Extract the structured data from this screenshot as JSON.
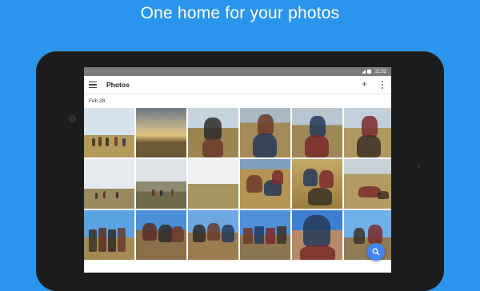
{
  "headline": "One home for your photos",
  "status_bar": {
    "time": "11:52"
  },
  "app_bar": {
    "title": "Photos",
    "menu_icon": "hamburger-menu-icon",
    "add_icon": "plus-icon",
    "more_icon": "more-vert-icon"
  },
  "section": {
    "date": "Feb 28"
  },
  "photos": [
    {
      "scene": "group of people standing on a sunny grassy hilltop"
    },
    {
      "scene": "sunset sky over hills"
    },
    {
      "scene": "man in sunglasses selfie on grassy hill"
    },
    {
      "scene": "woman with long hair on hillside"
    },
    {
      "scene": "man in plaid shirt outdoors"
    },
    {
      "scene": "smiling woman on grassy hill"
    },
    {
      "scene": "distant people on hill under pale sky"
    },
    {
      "scene": "hazy valley landscape with people"
    },
    {
      "scene": "bright sky over grassy slope"
    },
    {
      "scene": "group lying in tall grass"
    },
    {
      "scene": "group selfie in golden grass"
    },
    {
      "scene": "people relaxing on grassy slope"
    },
    {
      "scene": "group posing on hill under blue sky"
    },
    {
      "scene": "close-up group selfie under blue sky"
    },
    {
      "scene": "friends group selfie with sunglasses"
    },
    {
      "scene": "large group selfie on hilltop"
    },
    {
      "scene": "smiling woman selfie close-up"
    },
    {
      "scene": "man and woman selfie under blue sky"
    }
  ],
  "fab": {
    "icon": "search-icon"
  },
  "nav": {
    "back": "back-icon",
    "home": "home-icon",
    "recents": "recents-icon"
  },
  "colors": {
    "background": "#2a95ec",
    "fab": "#3f86f2",
    "status_bar": "#7b7b7b"
  }
}
